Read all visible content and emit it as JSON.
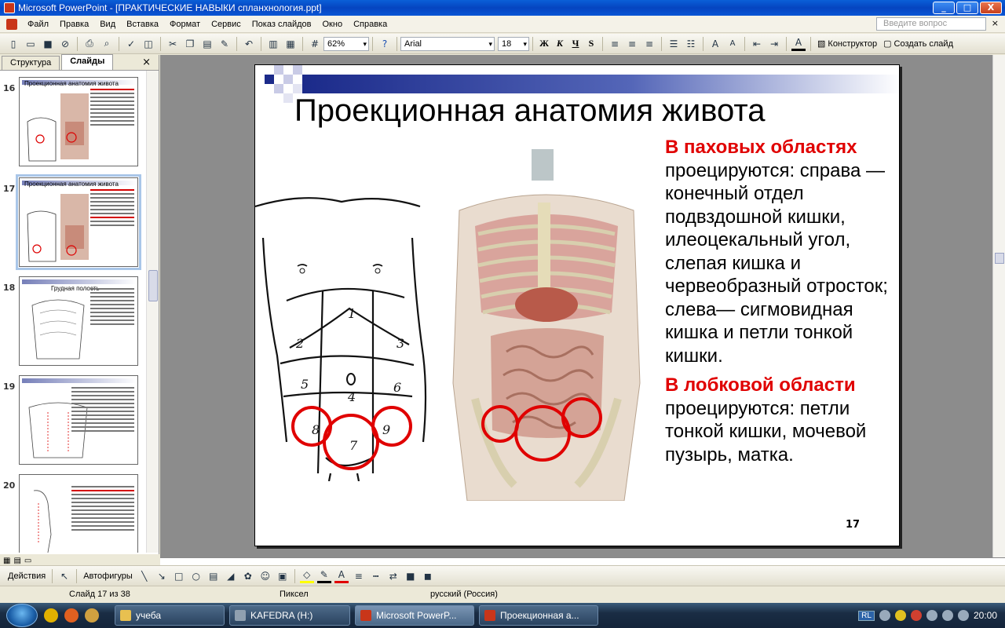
{
  "window": {
    "title": "Microsoft PowerPoint - [ПРАКТИЧЕСКИЕ НАВЫКИ спланхнология.ppt]",
    "buttons": [
      "_",
      "□",
      "X"
    ]
  },
  "menu": {
    "items": [
      "Файл",
      "Правка",
      "Вид",
      "Вставка",
      "Формат",
      "Сервис",
      "Показ слайдов",
      "Окно",
      "Справка"
    ],
    "help_placeholder": "Введите вопрос",
    "close": "×"
  },
  "toolbar": {
    "zoom": "62%",
    "font": "Arial",
    "font_size": "18",
    "bold": "Ж",
    "italic": "К",
    "underline": "Ч",
    "shadow": "S",
    "designer": "Конструктор",
    "new_slide": "Создать слайд"
  },
  "leftpane": {
    "tabs": [
      "Структура",
      "Слайды"
    ],
    "close": "×",
    "slides": [
      {
        "num": "16",
        "title": "Проекционная анатомия живота"
      },
      {
        "num": "17",
        "title": "Проекционная анатомия живота"
      },
      {
        "num": "18",
        "title": "Грудная полость"
      },
      {
        "num": "19",
        "title": ""
      },
      {
        "num": "20",
        "title": ""
      }
    ]
  },
  "slide": {
    "title": "Проекционная анатомия живота",
    "p1_head": "В паховых областях",
    "p1_body": "проецируются: справа — конечный отдел подвздошной кишки, илеоцекальный угол, слепая кишка и червеобразный отросток; слева— сигмовидная кишка и петли тонкой кишки.",
    "p2_head": "В лобковой области",
    "p2_body": "проецируются: петли тонкой кишки, мочевой пузырь, матка.",
    "number": "17",
    "region_labels": [
      "1",
      "2",
      "3",
      "4",
      "5",
      "6",
      "7",
      "8",
      "9"
    ]
  },
  "drawbar": {
    "actions": "Действия",
    "autoshapes": "Автофигуры"
  },
  "status": {
    "slide": "Слайд 17 из 38",
    "design": "Пиксел",
    "lang": "русский (Россия)"
  },
  "taskbar": {
    "tasks": [
      "учеба",
      "KAFEDRA (H:)",
      "Microsoft PowerP...",
      "Проекционная а..."
    ],
    "lang": "RL",
    "time": "20:00"
  },
  "colors": {
    "accent_red": "#e00000",
    "title_bar": "#0a56d6",
    "slide_band": "#1b2a8a"
  }
}
